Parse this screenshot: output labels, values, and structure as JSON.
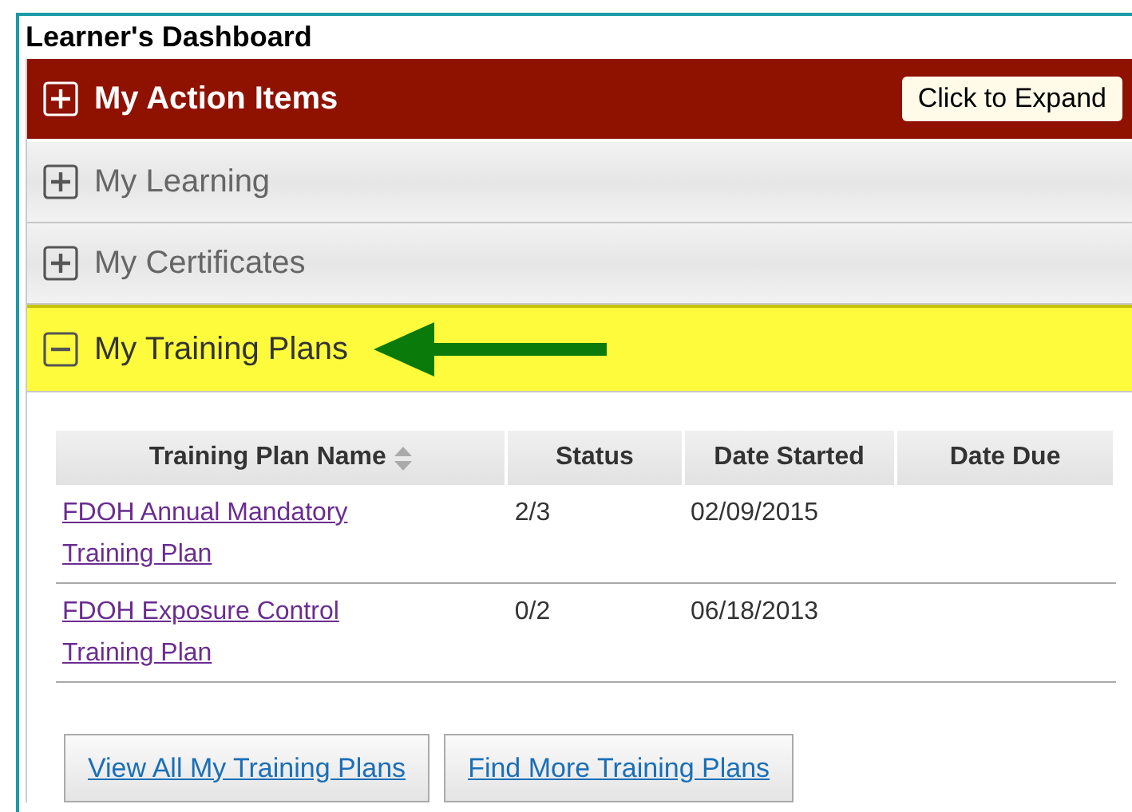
{
  "title": "Learner's Dashboard",
  "sections": [
    {
      "label": "My Action Items",
      "kind": "action",
      "expanded": false,
      "button": "Click to Expand"
    },
    {
      "label": "My Learning",
      "kind": "plain",
      "expanded": false
    },
    {
      "label": "My Certificates",
      "kind": "plain",
      "expanded": false
    },
    {
      "label": "My Training Plans",
      "kind": "highlight",
      "expanded": true,
      "pointer_arrow": true
    }
  ],
  "table": {
    "columns": [
      {
        "label": "Training Plan Name",
        "sortable": true
      },
      {
        "label": "Status",
        "sortable": false
      },
      {
        "label": "Date Started",
        "sortable": false
      },
      {
        "label": "Date Due",
        "sortable": false
      }
    ],
    "rows": [
      {
        "name": "FDOH Annual Mandatory Training Plan",
        "status": "2/3",
        "date_started": "02/09/2015"
      },
      {
        "name": "FDOH Exposure Control Training Plan",
        "status": "0/2",
        "date_started": "06/18/2013"
      }
    ]
  },
  "buttons": [
    "View All My Training Plans",
    "Find More Training Plans"
  ]
}
